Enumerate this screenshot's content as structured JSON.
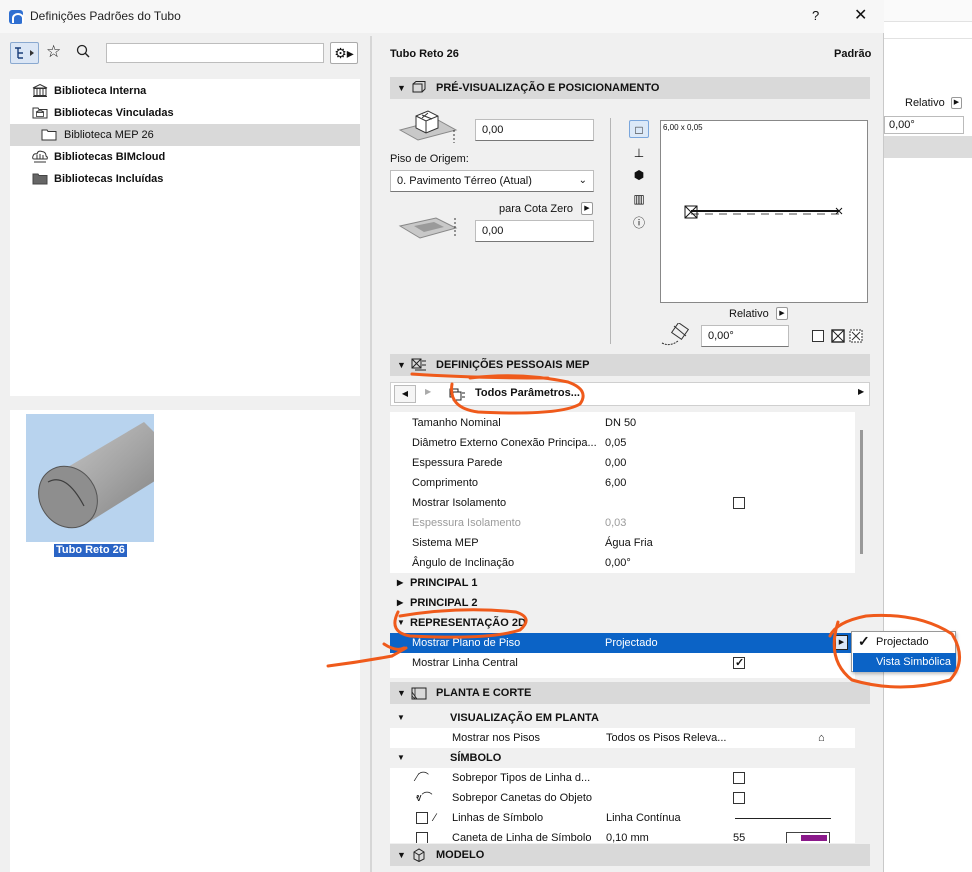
{
  "window": {
    "title": "Definições Padrões do Tubo",
    "help": "?",
    "close": "✕"
  },
  "background_app": {
    "relativo_label": "Relativo",
    "angle_value": "0,00°"
  },
  "library_tree": {
    "items": [
      {
        "label": "Biblioteca Interna"
      },
      {
        "label": "Bibliotecas Vinculadas"
      },
      {
        "label": "Biblioteca MEP 26"
      },
      {
        "label": "Bibliotecas BIMcloud"
      },
      {
        "label": "Bibliotecas Incluídas"
      }
    ]
  },
  "preview": {
    "object_label": "Tubo Reto 26"
  },
  "header": {
    "object_name": "Tubo Reto 26",
    "status": "Padrão"
  },
  "sections": {
    "preview_positioning": "PRÉ-VISUALIZAÇÃO E POSICIONAMENTO",
    "mep_settings": "DEFINIÇÕES PESSOAIS MEP",
    "plan_section": "PLANTA E CORTE",
    "model": "MODELO"
  },
  "positioning": {
    "offset_value": "0,00",
    "origin_floor_label": "Piso de Origem:",
    "origin_floor_value": "0. Pavimento Térreo (Atual)",
    "zero_level_label": "para Cota Zero",
    "zero_level_value": "0,00",
    "canvas_dim": "6,00 x 0,05",
    "relativo_label": "Relativo",
    "angle_value": "0,00°"
  },
  "params_nav": {
    "page_label": "Todos Parâmetros..."
  },
  "params": [
    {
      "name": "Tamanho Nominal",
      "value": "DN 50"
    },
    {
      "name": "Diâmetro Externo Conexão Principa...",
      "value": "0,05"
    },
    {
      "name": "Espessura Parede",
      "value": "0,00"
    },
    {
      "name": "Comprimento",
      "value": "6,00"
    },
    {
      "name": "Mostrar Isolamento",
      "value": ""
    },
    {
      "name": "Espessura Isolamento",
      "value": "0,03"
    },
    {
      "name": "Sistema MEP",
      "value": "Água Fria"
    },
    {
      "name": "Ângulo de Inclinação",
      "value": "0,00°"
    }
  ],
  "groups": {
    "principal1": "PRINCIPAL 1",
    "principal2": "PRINCIPAL 2",
    "rep2d": "REPRESENTAÇÃO 2D"
  },
  "rep2d_rows": {
    "floor_plan_name": "Mostrar Plano de Piso",
    "floor_plan_value": "Projectado",
    "center_line_name": "Mostrar Linha Central"
  },
  "dropdown": {
    "options": [
      "Projectado",
      "Vista Simbólica"
    ],
    "checked_option": "Projectado",
    "hovered_option": "Vista Simbólica"
  },
  "plan_rows": {
    "plan_view": "VISUALIZAÇÃO EM PLANTA",
    "show_on_floors": "Mostrar nos Pisos",
    "show_on_floors_value": "Todos os Pisos Releva...",
    "symbol": "SÍMBOLO",
    "override_line_types": "Sobrepor Tipos de Linha d...",
    "override_pens": "Sobrepor Canetas do Objeto",
    "symbol_lines": "Linhas de Símbolo",
    "symbol_lines_value": "Linha Contínua",
    "symbol_pen": "Caneta de Linha de Símbolo",
    "symbol_pen_value": "0,10 mm",
    "symbol_pen_number": "55"
  },
  "colors": {
    "selection_blue": "#0b63c6",
    "annotation_orange": "#ef5a1b",
    "pen_swatch": "#8b1a8b"
  }
}
